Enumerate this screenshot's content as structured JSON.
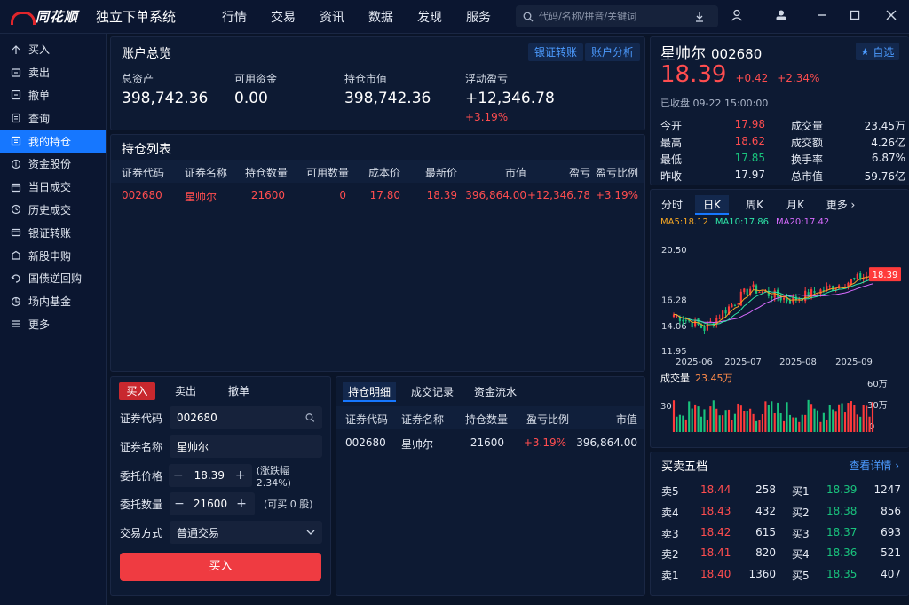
{
  "app": {
    "brand": "同花顺",
    "title": "独立下单系统",
    "menu": [
      "行情",
      "交易",
      "资讯",
      "数据",
      "发现",
      "服务"
    ],
    "search_placeholder": "代码/名称/拼音/关键词"
  },
  "sidebar": {
    "items": [
      {
        "label": "买入",
        "icon": "buy-icon"
      },
      {
        "label": "卖出",
        "icon": "sell-icon"
      },
      {
        "label": "撤单",
        "icon": "cancel-order-icon"
      },
      {
        "label": "查询",
        "icon": "query-icon"
      },
      {
        "label": "我的持仓",
        "icon": "holdings-icon",
        "active": true
      },
      {
        "label": "资金股份",
        "icon": "funds-icon"
      },
      {
        "label": "当日成交",
        "icon": "today-deals-icon"
      },
      {
        "label": "历史成交",
        "icon": "history-icon"
      },
      {
        "label": "银证转账",
        "icon": "transfer-icon"
      },
      {
        "label": "新股申购",
        "icon": "ipo-icon"
      },
      {
        "label": "国债逆回购",
        "icon": "repo-icon"
      },
      {
        "label": "场内基金",
        "icon": "fund-icon"
      },
      {
        "label": "更多",
        "icon": "more-icon"
      }
    ]
  },
  "overview": {
    "title": "账户总览",
    "transfer_btn": "银证转账",
    "analysis_btn": "账户分析",
    "total_assets_label": "总资产",
    "total_assets": "398,742.36",
    "available_label": "可用资金",
    "available": "0.00",
    "market_value_label": "持仓市值",
    "market_value": "398,742.36",
    "float_pl_label": "浮动盈亏",
    "float_pl": "+12,346.78",
    "float_pl_pct": "+3.19%"
  },
  "positions": {
    "title": "持仓列表",
    "columns": [
      "证券代码",
      "证券名称",
      "持仓数量",
      "可用数量",
      "成本价",
      "最新价",
      "市值",
      "盈亏",
      "盈亏比例"
    ],
    "rows": [
      [
        "002680",
        "星帅尔",
        "21600",
        "0",
        "17.80",
        "18.39",
        "396,864.00",
        "+12,346.78",
        "+3.19%"
      ]
    ]
  },
  "trade": {
    "tabs": [
      "买入",
      "卖出",
      "撤单"
    ],
    "code_label": "证券代码",
    "code": "002680",
    "name_label": "证券名称",
    "name": "星帅尔",
    "price_label": "委托价格",
    "price": "18.39",
    "price_note": "(涨跌幅 2.34%)",
    "qty_label": "委托数量",
    "qty": "21600",
    "qty_note": "(可买 0 股)",
    "mode_label": "交易方式",
    "mode": "普通交易",
    "submit": "买入"
  },
  "detail": {
    "tabs": [
      "持仓明细",
      "成交记录",
      "资金流水"
    ],
    "columns": [
      "证券代码",
      "证券名称",
      "持仓数量",
      "盈亏比例",
      "市值"
    ],
    "rows": [
      [
        "002680",
        "星帅尔",
        "21600",
        "+3.19%",
        "396,864.00"
      ]
    ]
  },
  "quote": {
    "name": "星帅尔",
    "code": "002680",
    "watch_btn": "自选",
    "price": "18.39",
    "change": "+0.42",
    "change_pct": "+2.34%",
    "status": "已收盘 09-22 15:00:00",
    "stats": [
      [
        "今开",
        "17.98",
        "成交量",
        "23.45万"
      ],
      [
        "最高",
        "18.62",
        "成交额",
        "4.26亿"
      ],
      [
        "最低",
        "17.85",
        "换手率",
        "6.87%"
      ],
      [
        "昨收",
        "17.97",
        "总市值",
        "59.76亿"
      ]
    ]
  },
  "kline": {
    "tabs": [
      "分时",
      "日K",
      "周K",
      "月K",
      "更多 ›"
    ],
    "ma5": "MA5:18.12",
    "ma10": "MA10:17.86",
    "ma20": "MA20:17.42",
    "y_ticks": [
      "20.50",
      "16.28",
      "14.06",
      "11.95"
    ],
    "x_ticks": [
      "2025-06",
      "2025-07",
      "2025-08",
      "2025-09"
    ],
    "last_price_tag": "18.39",
    "vol_label": "成交量",
    "vol_value": "23.45万",
    "vol_ticks": [
      "60万",
      "30万",
      "0"
    ],
    "vol_left_tick": "30",
    "colors": {
      "up": "#ff3b3b",
      "down": "#19c37d",
      "ma5": "#f5a623",
      "ma10": "#2ee6a8",
      "ma20": "#d86bff"
    }
  },
  "book": {
    "title": "买卖五档",
    "more": "查看详情 ›",
    "asks": [
      [
        "卖5",
        "18.44",
        "258"
      ],
      [
        "卖4",
        "18.43",
        "432"
      ],
      [
        "卖3",
        "18.42",
        "615"
      ],
      [
        "卖2",
        "18.41",
        "820"
      ],
      [
        "卖1",
        "18.40",
        "1360"
      ]
    ],
    "bids": [
      [
        "买1",
        "18.39",
        "1247"
      ],
      [
        "买2",
        "18.38",
        "856"
      ],
      [
        "买3",
        "18.37",
        "693"
      ],
      [
        "买4",
        "18.36",
        "521"
      ],
      [
        "买5",
        "18.35",
        "407"
      ]
    ]
  }
}
